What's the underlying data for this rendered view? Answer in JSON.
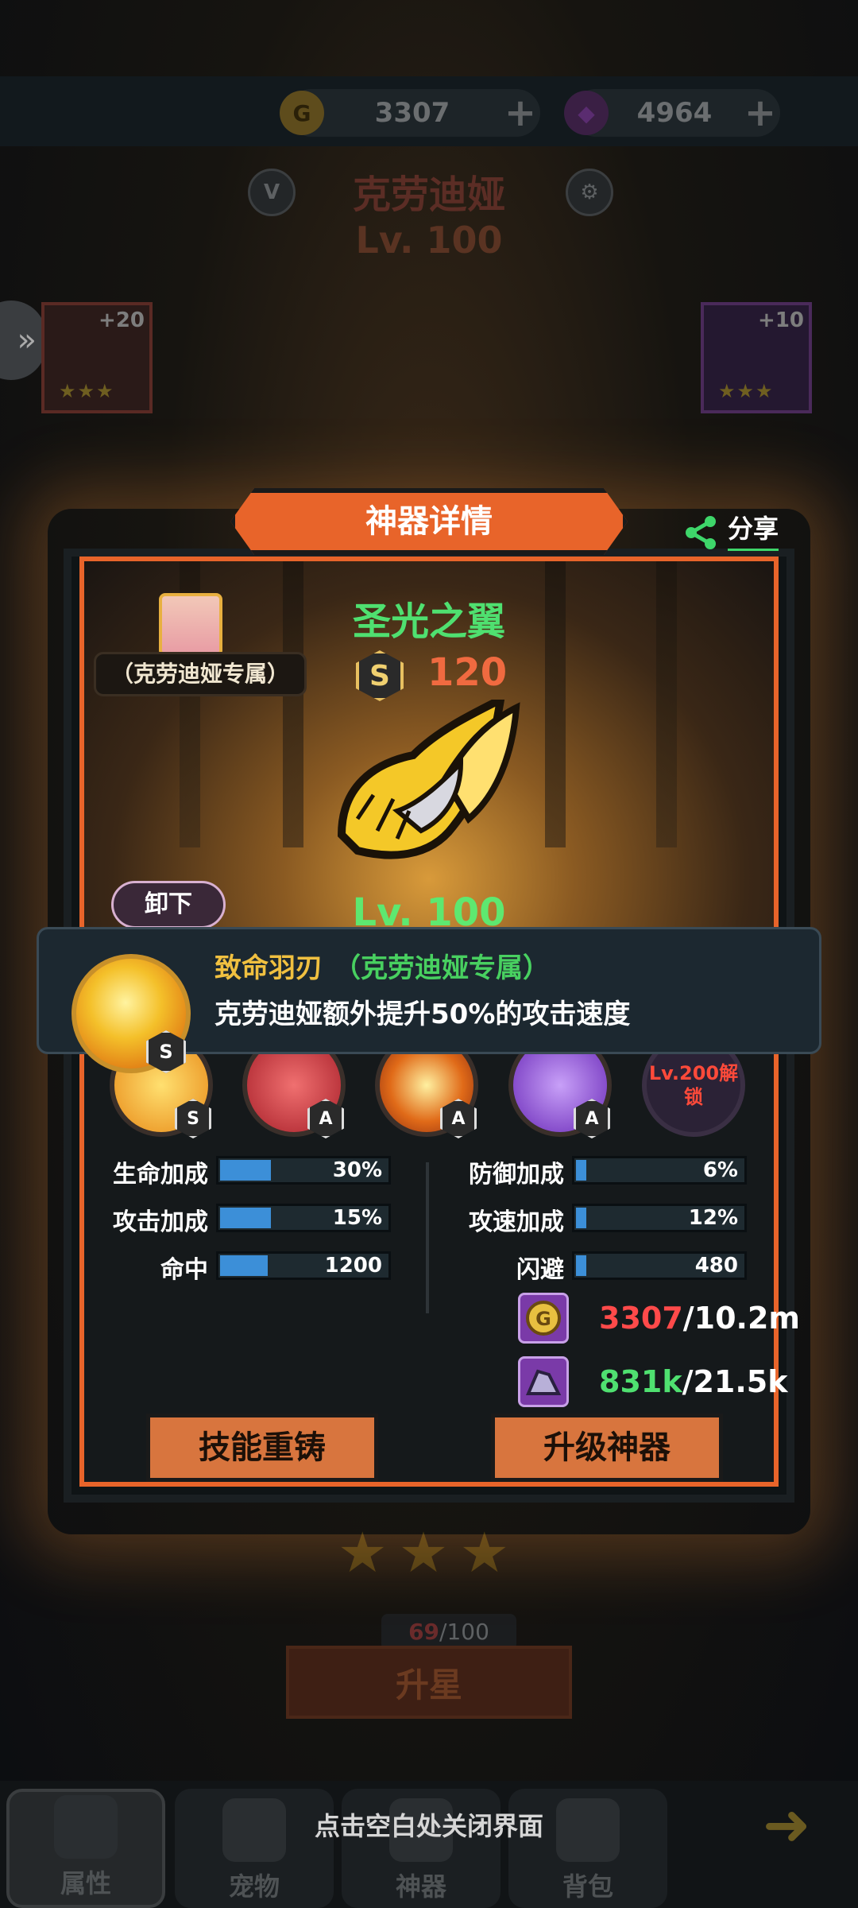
{
  "top": {
    "gold": "3307",
    "gems": "4964",
    "hero_name": "克劳迪娅",
    "hero_level": "Lv. 100",
    "vip_badge": "V"
  },
  "equip_slots": [
    {
      "plus": "+20",
      "stars": "★★★"
    },
    {
      "plus": "+10",
      "stars": "★★★"
    }
  ],
  "dialog": {
    "title": "神器详情",
    "share": "分享",
    "owner_tag": "（克劳迪娅专属）",
    "artifact_name": "圣光之翼",
    "grade": "S",
    "score": "120",
    "unequip": "卸下",
    "level": "Lv. 100"
  },
  "tooltip": {
    "grade": "S",
    "name": "致命羽刃",
    "exclusive": "（克劳迪娅专属）",
    "description": "克劳迪娅额外提升50%的攻击速度"
  },
  "skills": [
    {
      "grade": "S",
      "color": "#f4b020"
    },
    {
      "grade": "A",
      "color": "#d8404a"
    },
    {
      "grade": "A",
      "color": "#e87020"
    },
    {
      "grade": "A",
      "color": "#8a48d8"
    },
    {
      "locked_text": "Lv.200解锁"
    }
  ],
  "stats_left": [
    {
      "label": "生命加成",
      "value": "30%",
      "fill": 0.3
    },
    {
      "label": "攻击加成",
      "value": "15%",
      "fill": 0.3
    },
    {
      "label": "命中",
      "value": "1200",
      "fill": 0.28
    }
  ],
  "stats_right": [
    {
      "label": "防御加成",
      "value": "6%",
      "fill": 0.06
    },
    {
      "label": "攻速加成",
      "value": "12%",
      "fill": 0.06
    },
    {
      "label": "闪避",
      "value": "480",
      "fill": 0.06
    }
  ],
  "costs": [
    {
      "have": "3307",
      "need": "/10.2m",
      "have_color": "#ff4a4a",
      "icon": "gold-coin-icon"
    },
    {
      "have": "831k",
      "need": "/21.5k",
      "have_color": "#4fe070",
      "icon": "crystal-ore-icon"
    }
  ],
  "buttons": {
    "reforge": "技能重铸",
    "upgrade": "升级神器"
  },
  "bottom": {
    "stars": "★★★",
    "shard_have": "69",
    "shard_need": "/100",
    "star_up": "升星",
    "close_hint": "点击空白处关闭界面",
    "tabs": [
      "属性",
      "宠物",
      "神器",
      "背包"
    ]
  },
  "colors": {
    "accent_orange": "#e8642a",
    "name_green": "#4fe070",
    "bar_blue": "#3c8fd8"
  }
}
